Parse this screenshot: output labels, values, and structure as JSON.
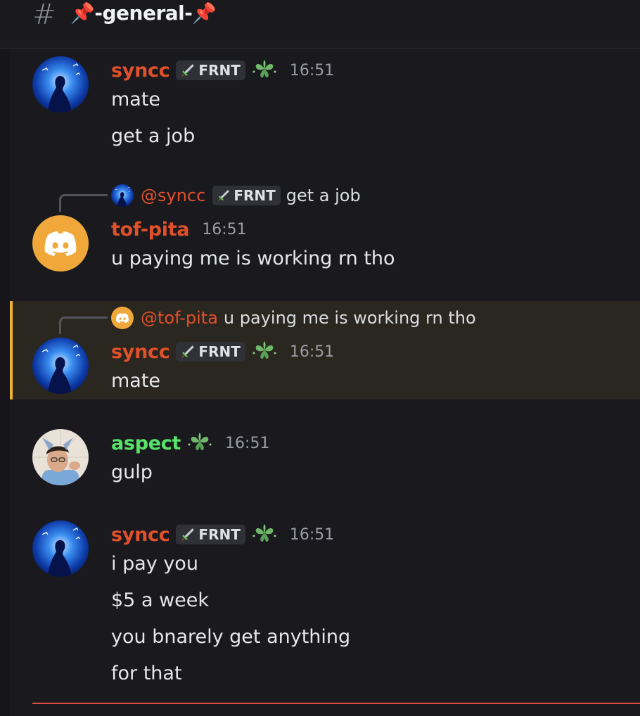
{
  "channel": {
    "hash": "#",
    "name": "📌-general-📌"
  },
  "colors": {
    "accent_red": "#e0502b",
    "accent_green": "#57e36a",
    "mention_highlight": "#f0b232",
    "new_divider": "#d84a40"
  },
  "messages": [
    {
      "author": "syncc",
      "tag": "FRNT",
      "time": "16:51",
      "lines": [
        "mate",
        "get a job"
      ]
    },
    {
      "reply_to": {
        "mention": "@syncc",
        "tag": "FRNT",
        "text": "get a job"
      },
      "author": "tof-pita",
      "time": "16:51",
      "lines": [
        "u paying me is working rn tho"
      ]
    },
    {
      "reply_to": {
        "mention": "@tof-pita",
        "text": "u paying me is working rn tho"
      },
      "author": "syncc",
      "tag": "FRNT",
      "time": "16:51",
      "lines": [
        "mate"
      ]
    },
    {
      "author": "aspect",
      "time": "16:51",
      "lines": [
        "gulp"
      ]
    },
    {
      "author": "syncc",
      "tag": "FRNT",
      "time": "16:51",
      "lines": [
        "i pay you",
        "$5 a week",
        "you bnarely get anything",
        "for that"
      ]
    }
  ]
}
